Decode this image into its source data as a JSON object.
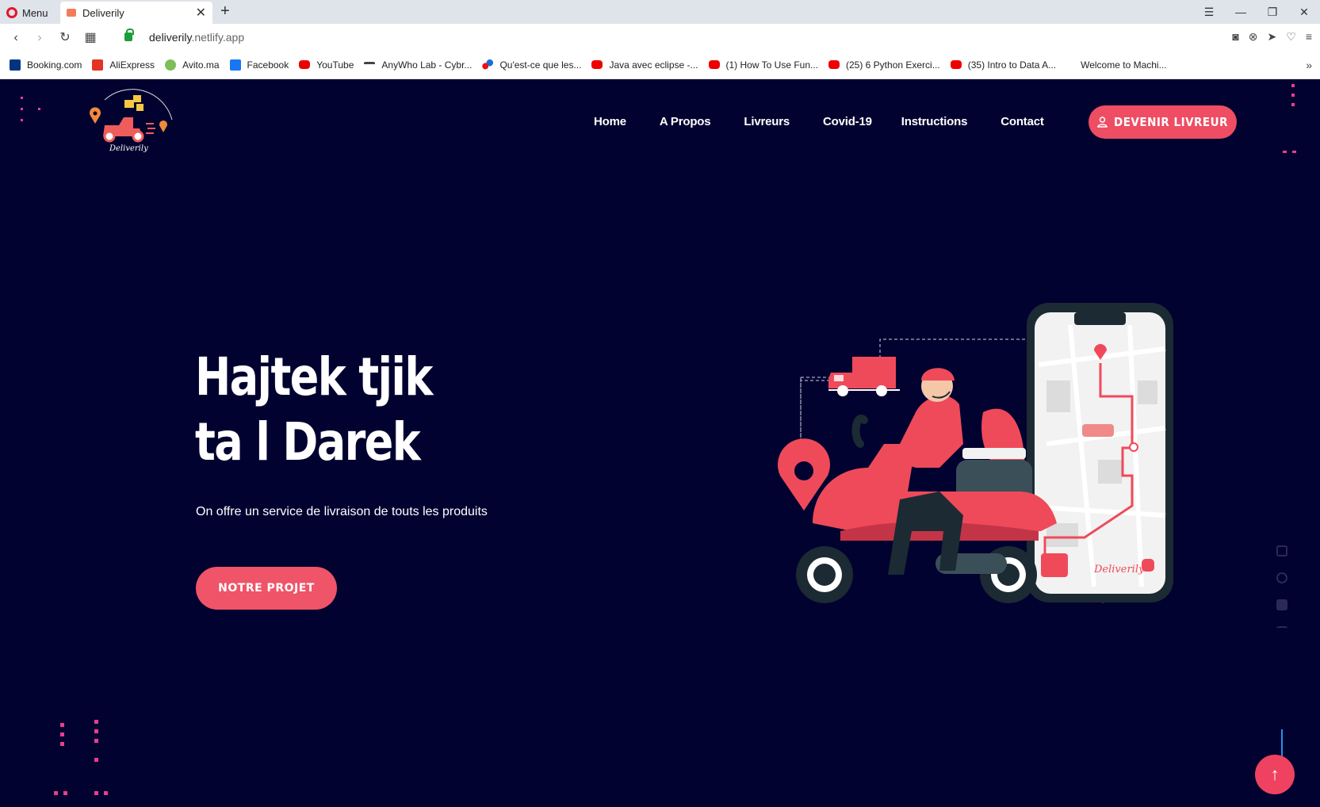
{
  "browser": {
    "menu_label": "Menu",
    "tab_title": "Deliverily",
    "url_host": "deliverily",
    "url_rest": ".netlify.app",
    "bookmarks": [
      {
        "label": "Booking.com",
        "icon": "booking-icon"
      },
      {
        "label": "AliExpress",
        "icon": "aliexpress-icon"
      },
      {
        "label": "Avito.ma",
        "icon": "avito-icon"
      },
      {
        "label": "Facebook",
        "icon": "facebook-icon"
      },
      {
        "label": "YouTube",
        "icon": "youtube-icon"
      },
      {
        "label": "AnyWho Lab - Cybr...",
        "icon": "anywho-icon"
      },
      {
        "label": "Qu'est-ce que les...",
        "icon": "quest-icon"
      },
      {
        "label": "Java avec eclipse -...",
        "icon": "youtube-icon"
      },
      {
        "label": "(1) How To Use Fun...",
        "icon": "youtube-icon"
      },
      {
        "label": "(25) 6 Python Exerci...",
        "icon": "youtube-icon"
      },
      {
        "label": "(35) Intro to Data A...",
        "icon": "youtube-icon"
      },
      {
        "label": "Welcome to Machi...",
        "icon": "none"
      }
    ]
  },
  "site": {
    "logo_text": "Deliverily",
    "nav": [
      "Home",
      "A Propos",
      "Livreurs",
      "Covid-19",
      "Instructions",
      "Contact"
    ],
    "cta_top": "DEVENIR LIVREUR",
    "hero_line1": "Hajtek tjik",
    "hero_line2": "ta l Darek",
    "hero_subtitle": "On offre un service de livraison de touts les produits",
    "cta_main": "NOTRE PROJET",
    "phone_label": "Deliverily"
  },
  "colors": {
    "background": "#020230",
    "accent": "#ee4d63",
    "dots": "#e83e8c"
  }
}
